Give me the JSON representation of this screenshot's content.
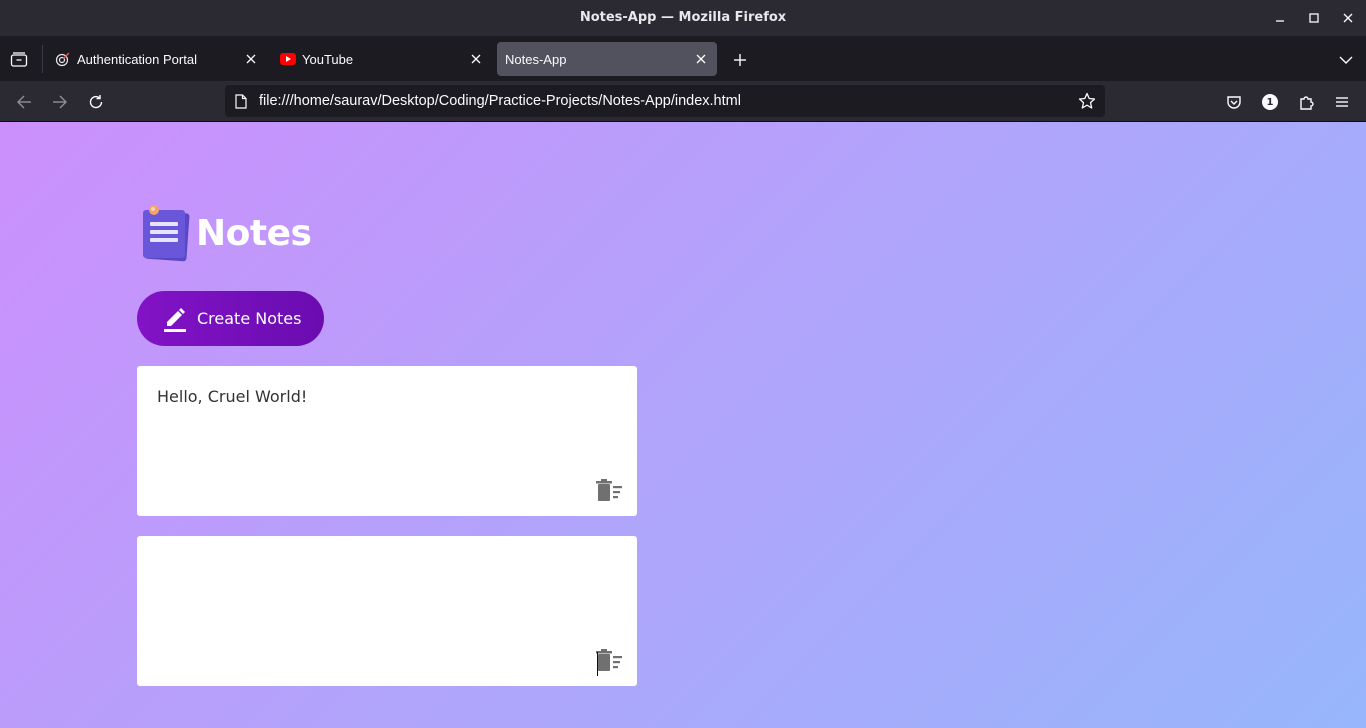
{
  "window": {
    "title": "Notes-App — Mozilla Firefox"
  },
  "tabs": [
    {
      "label": "Authentication Portal",
      "favicon": "target-icon"
    },
    {
      "label": "YouTube",
      "favicon": "youtube-icon"
    },
    {
      "label": "Notes-App",
      "favicon": "none",
      "active": true
    }
  ],
  "navbar": {
    "url": "file:///home/saurav/Desktop/Coding/Practice-Projects/Notes-App/index.html",
    "extension_badge": "1"
  },
  "page": {
    "heading": "Notes",
    "create_button_label": "Create Notes",
    "notes": [
      {
        "text": "Hello, Cruel World!"
      },
      {
        "text": ""
      }
    ]
  },
  "colors": {
    "gradient_start": "#cc8ffc",
    "gradient_end": "#97b6fb",
    "button": "#7a10c0",
    "note_bg": "#ffffff"
  }
}
